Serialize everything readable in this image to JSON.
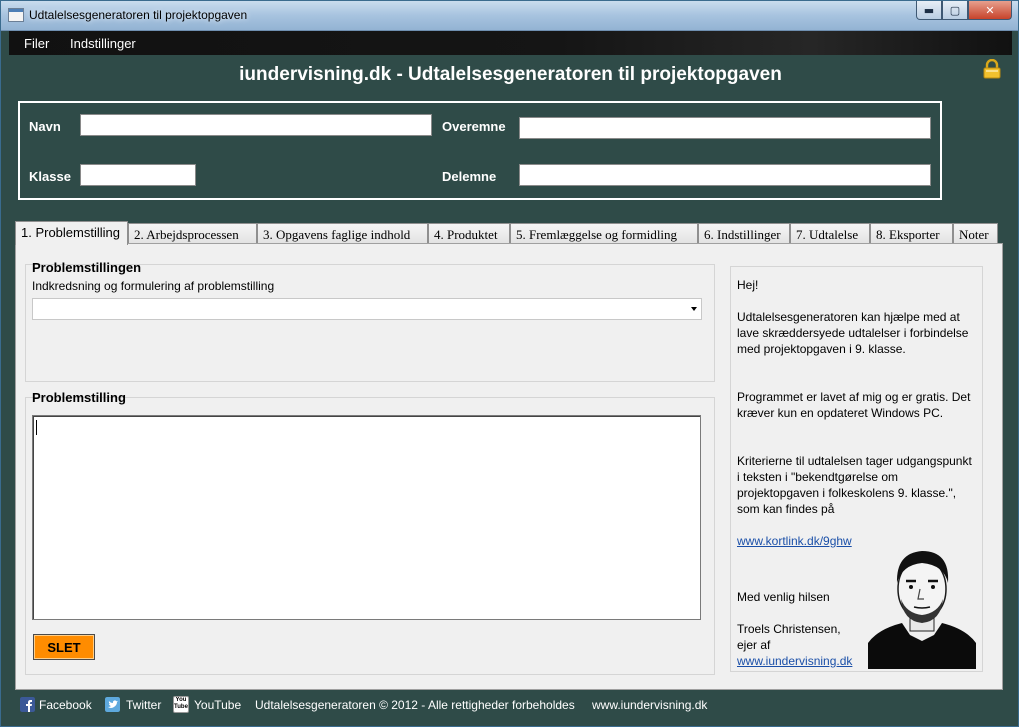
{
  "window": {
    "title": "Udtalelsesgeneratoren til projektopgaven",
    "minimize": "▬",
    "maximize": "▢",
    "close": "✕"
  },
  "menu": {
    "items": [
      "Filer",
      "Indstillinger"
    ]
  },
  "header": {
    "title": "iundervisning.dk - Udtalelsesgeneratoren til projektopgaven",
    "name_label": "Navn",
    "name_value": "",
    "class_label": "Klasse",
    "class_value": "",
    "topic_label": "Overemne",
    "topic_value": "",
    "subtopic_label": "Delemne",
    "subtopic_value": ""
  },
  "tabs": [
    "1. Problemstilling",
    "2. Arbejdsprocessen",
    "3. Opgavens faglige indhold",
    "4. Produktet",
    "5. Fremlæggelse og formidling",
    "6. Indstillinger",
    "7. Udtalelse",
    "8. Eksporter",
    "Noter"
  ],
  "problem_group": {
    "title": "Problemstillingen",
    "subtitle": "Indkredsning og formulering af problemstilling",
    "selected": ""
  },
  "problem_text_group": {
    "title": "Problemstilling",
    "value": "",
    "delete_button": "SLET"
  },
  "info": {
    "greeting": "Hej!",
    "p1": "Udtalelsesgeneratoren kan hjælpe med at lave skræddersyede udtalelser i forbindelse med projektopgaven i 9. klasse.",
    "p2": "Programmet er lavet af mig og er gratis. Det kræver kun en opdateret Windows PC.",
    "p3": "Kriterierne til udtalelsen tager udgangspunkt i teksten i \"bekendtgørelse om projektopgaven i folkeskolens 9. klasse.\", som kan findes på",
    "link1": "www.kortlink.dk/9ghw",
    "regards": "Med venlig hilsen",
    "author": "Troels Christensen,",
    "role": "ejer af",
    "link2": "www.iundervisning.dk"
  },
  "footer": {
    "facebook": "Facebook",
    "twitter": "Twitter",
    "youtube": "YouTube",
    "youtube_badge": "You Tube",
    "copyright": "Udtalelsesgeneratoren © 2012 - Alle rettigheder forbeholdes",
    "site": "www.iundervisning.dk"
  },
  "colors": {
    "background": "#2f4b48",
    "accent_button": "#ff8c00",
    "link": "#1a4fa8"
  },
  "icons": [
    "app-icon",
    "lock-icon",
    "dropdown-arrow-icon",
    "facebook-icon",
    "twitter-icon",
    "youtube-icon",
    "author-portrait"
  ]
}
